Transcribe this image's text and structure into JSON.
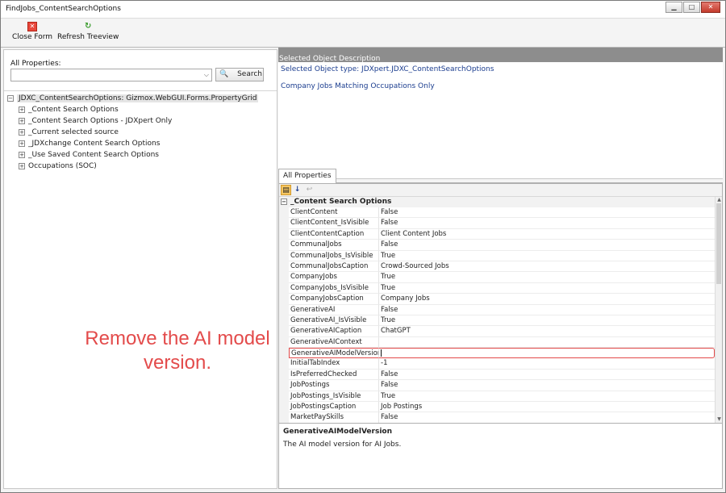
{
  "window": {
    "title": "FindJobs_ContentSearchOptions",
    "controls": [
      "minimize-icon",
      "maximize-icon",
      "close-icon"
    ]
  },
  "toolbar": {
    "close_form": "Close Form",
    "refresh_treeview": "Refresh Treeview"
  },
  "left": {
    "all_properties_label": "All Properties:",
    "combo_value": "",
    "search_button": "Search",
    "tree": {
      "root": "JDXC_ContentSearchOptions: Gizmox.WebGUI.Forms.PropertyGrid",
      "children": [
        "_Content Search Options",
        "_Content Search Options - JDXpert Only",
        "_Current selected source",
        "_JDXchange Content Search Options",
        "_Use Saved Content Search Options",
        "Occupations (SOC)"
      ]
    },
    "instruction": "Remove the AI model version."
  },
  "right": {
    "sod_header": "Selected Object Description",
    "selected_object_type": "Selected Object type: JDXpert.JDXC_ContentSearchOptions",
    "selected_object_desc": "Company Jobs Matching Occupations Only",
    "tab_label": "All Properties",
    "category": "_Content Search Options",
    "rows": [
      {
        "name": "ClientContent",
        "value": "False"
      },
      {
        "name": "ClientContent_IsVisible",
        "value": "False"
      },
      {
        "name": "ClientContentCaption",
        "value": "Client Content Jobs"
      },
      {
        "name": "CommunalJobs",
        "value": "False"
      },
      {
        "name": "CommunalJobs_IsVisible",
        "value": "True"
      },
      {
        "name": "CommunalJobsCaption",
        "value": "Crowd-Sourced Jobs"
      },
      {
        "name": "CompanyJobs",
        "value": "True"
      },
      {
        "name": "CompanyJobs_IsVisible",
        "value": "True"
      },
      {
        "name": "CompanyJobsCaption",
        "value": "Company Jobs"
      },
      {
        "name": "GenerativeAI",
        "value": "False"
      },
      {
        "name": "GenerativeAI_IsVisible",
        "value": "True"
      },
      {
        "name": "GenerativeAICaption",
        "value": "ChatGPT"
      },
      {
        "name": "GenerativeAIContext",
        "value": ""
      },
      {
        "name": "GenerativeAIModelVersion",
        "value": ""
      },
      {
        "name": "InitialTabIndex",
        "value": "-1"
      },
      {
        "name": "IsPreferredChecked",
        "value": "False"
      },
      {
        "name": "JobPostings",
        "value": "False"
      },
      {
        "name": "JobPostings_IsVisible",
        "value": "True"
      },
      {
        "name": "JobPostingsCaption",
        "value": "Job Postings"
      },
      {
        "name": "MarketPaySkills",
        "value": "False"
      }
    ],
    "help_title": "GenerativeAIModelVersion",
    "help_desc": "The AI model version for AI Jobs."
  }
}
